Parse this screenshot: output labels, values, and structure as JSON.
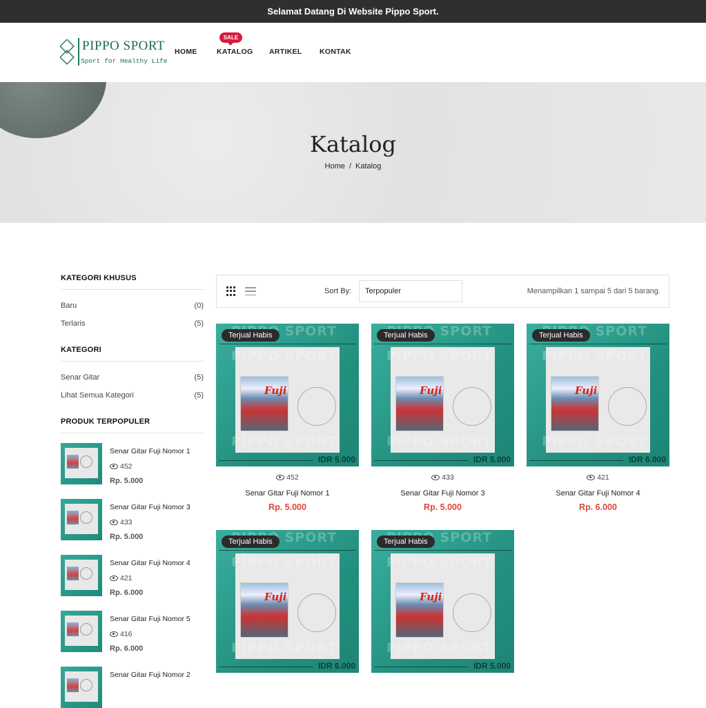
{
  "topbar": {
    "text": "Selamat Datang Di Website Pippo Sport."
  },
  "logo": {
    "name": "PIPPO SPORT",
    "tagline": "Sport for Healthy Life"
  },
  "nav": {
    "home": "HOME",
    "katalog": "KATALOG",
    "artikel": "ARTIKEL",
    "kontak": "KONTAK",
    "sale_badge": "SALE"
  },
  "hero": {
    "title": "Katalog",
    "breadcrumb_home": "Home",
    "breadcrumb_sep": "/",
    "breadcrumb_current": "Katalog"
  },
  "sidebar": {
    "special_title": "KATEGORI KHUSUS",
    "special": [
      {
        "label": "Baru",
        "count": "(0)"
      },
      {
        "label": "Terlaris",
        "count": "(5)"
      }
    ],
    "category_title": "KATEGORI",
    "categories": [
      {
        "label": "Senar Gitar",
        "count": "(5)"
      },
      {
        "label": "Lihat Semua Kategori",
        "count": "(5)"
      }
    ],
    "popular_title": "PRODUK TERPOPULER",
    "popular": [
      {
        "name": "Senar Gitar Fuji Nomor 1",
        "views": "452",
        "price": "Rp. 5.000"
      },
      {
        "name": "Senar Gitar Fuji Nomor 3",
        "views": "433",
        "price": "Rp. 5.000"
      },
      {
        "name": "Senar Gitar Fuji Nomor 4",
        "views": "421",
        "price": "Rp. 6.000"
      },
      {
        "name": "Senar Gitar Fuji Nomor 5",
        "views": "416",
        "price": "Rp. 6.000"
      },
      {
        "name": "Senar Gitar Fuji Nomor 2"
      }
    ]
  },
  "toolbar": {
    "sort_label": "Sort By:",
    "sort_value": "Terpopuler",
    "showing": "Menampilkan 1 sampai 5 dari 5 barang."
  },
  "products": [
    {
      "badge": "Terjual Habis",
      "watermark": "PIPPO SPORT",
      "image_price": "IDR 5.000",
      "views": "452",
      "name": "Senar Gitar Fuji Nomor 1",
      "price": "Rp. 5.000"
    },
    {
      "badge": "Terjual Habis",
      "watermark": "PIPPO SPORT",
      "image_price": "IDR 5.000",
      "views": "433",
      "name": "Senar Gitar Fuji Nomor 3",
      "price": "Rp. 5.000"
    },
    {
      "badge": "Terjual Habis",
      "watermark": "PIPPO SPORT",
      "image_price": "IDR 6.000",
      "views": "421",
      "name": "Senar Gitar Fuji Nomor 4",
      "price": "Rp. 6.000"
    },
    {
      "badge": "Terjual Habis",
      "watermark": "PIPPO SPORT",
      "image_price": "IDR 6.000"
    },
    {
      "badge": "Terjual Habis",
      "watermark": "PIPPO SPORT",
      "image_price": "IDR 5.000"
    }
  ],
  "colors": {
    "accent_price": "#e0453a",
    "sale_badge": "#d61c3b",
    "topbar_bg": "#2f2f2f",
    "product_bg": "#2a9d8c"
  }
}
